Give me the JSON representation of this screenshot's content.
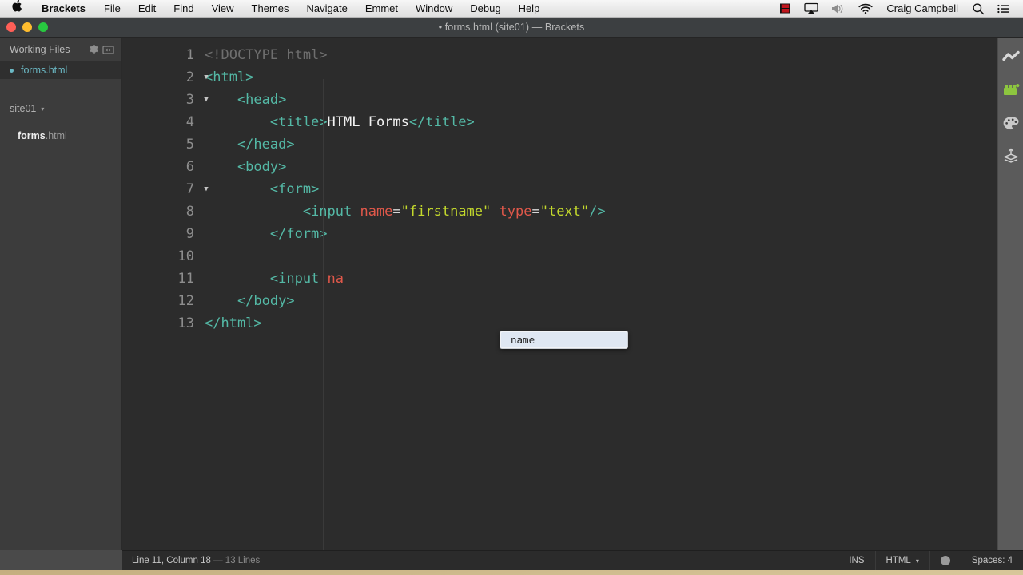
{
  "menubar": {
    "apple_icon": "apple-logo-icon",
    "app_name": "Brackets",
    "items": [
      "File",
      "Edit",
      "Find",
      "View",
      "Themes",
      "Navigate",
      "Emmet",
      "Window",
      "Debug",
      "Help"
    ],
    "status_icons": [
      "screen-recording-icon",
      "airplay-icon",
      "volume-icon",
      "wifi-icon"
    ],
    "user": "Craig Campbell",
    "right_icons": [
      "search-icon",
      "notification-center-icon"
    ],
    "accent_red": "#c0161d"
  },
  "window": {
    "title": "• forms.html (site01) — Brackets",
    "traffic_lights": [
      "close",
      "minimize",
      "maximize"
    ]
  },
  "sidebar": {
    "working_files_label": "Working Files",
    "header_icons": [
      "gear-icon",
      "split-view-icon"
    ],
    "working_files": [
      {
        "name": "forms.html",
        "dirty": true,
        "selected": true
      }
    ],
    "project_name": "site01",
    "project_caret": "▾",
    "tree": [
      {
        "base": "forms",
        "ext": ".html"
      }
    ]
  },
  "editor": {
    "total_lines": 13,
    "lines": [
      {
        "num": 1,
        "fold": false,
        "tokens": [
          {
            "t": "doctype",
            "v": "<!DOCTYPE html>"
          }
        ]
      },
      {
        "num": 2,
        "fold": true,
        "tokens": [
          {
            "t": "tag",
            "v": "<html>"
          }
        ]
      },
      {
        "num": 3,
        "fold": true,
        "tokens": [
          {
            "t": "tag",
            "v": "    <head>"
          }
        ]
      },
      {
        "num": 4,
        "fold": false,
        "tokens": [
          {
            "t": "tag",
            "v": "        <title>"
          },
          {
            "t": "text",
            "v": "HTML Forms"
          },
          {
            "t": "tag",
            "v": "</title>"
          }
        ]
      },
      {
        "num": 5,
        "fold": false,
        "tokens": [
          {
            "t": "tag",
            "v": "    </head>"
          }
        ]
      },
      {
        "num": 6,
        "fold": false,
        "tokens": [
          {
            "t": "tag",
            "v": "    <body>"
          }
        ]
      },
      {
        "num": 7,
        "fold": true,
        "tokens": [
          {
            "t": "tag",
            "v": "        <form>"
          }
        ]
      },
      {
        "num": 8,
        "fold": false,
        "tokens": [
          {
            "t": "tag",
            "v": "            <input "
          },
          {
            "t": "attr",
            "v": "name"
          },
          {
            "t": "eq",
            "v": "="
          },
          {
            "t": "val",
            "v": "\"firstname\""
          },
          {
            "t": "text",
            "v": " "
          },
          {
            "t": "attr",
            "v": "type"
          },
          {
            "t": "eq",
            "v": "="
          },
          {
            "t": "val",
            "v": "\"text\""
          },
          {
            "t": "tag",
            "v": "/>"
          }
        ]
      },
      {
        "num": 9,
        "fold": false,
        "tokens": [
          {
            "t": "tag",
            "v": "        </form>"
          }
        ]
      },
      {
        "num": 10,
        "fold": false,
        "tokens": []
      },
      {
        "num": 11,
        "fold": false,
        "tokens": [
          {
            "t": "tag",
            "v": "        <input "
          },
          {
            "t": "attr",
            "v": "na"
          }
        ],
        "caret": true
      },
      {
        "num": 12,
        "fold": false,
        "tokens": [
          {
            "t": "tag",
            "v": "    </body>"
          }
        ]
      },
      {
        "num": 13,
        "fold": false,
        "tokens": [
          {
            "t": "tag",
            "v": "</html>"
          }
        ]
      }
    ]
  },
  "autocomplete": {
    "items": [
      "name"
    ],
    "selected_index": 0
  },
  "toolbar": {
    "buttons": [
      "live-preview-icon",
      "extension-manager-icon",
      "theme-palette-icon",
      "extract-layers-icon"
    ],
    "extension_badge_color": "#8dc63f"
  },
  "statusbar": {
    "cursor": "Line 11, Column 18",
    "separator": "—",
    "lines_count": "13 Lines",
    "insert_mode": "INS",
    "language": "HTML",
    "language_caret": "▾",
    "live_preview_icon": "live-preview-circle-icon",
    "indent": "Spaces: 4"
  }
}
